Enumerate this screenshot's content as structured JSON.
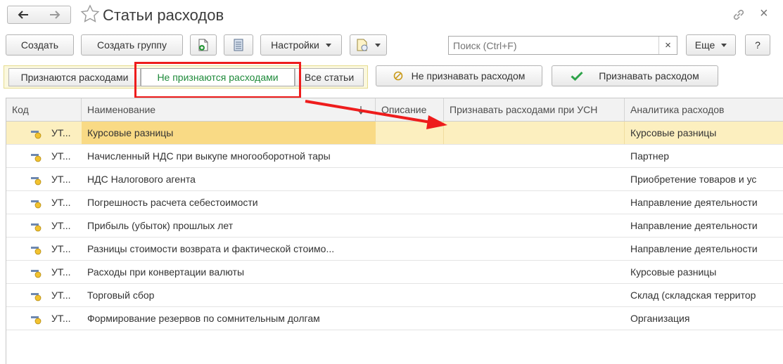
{
  "window": {
    "title": "Статьи расходов",
    "back_icon": "arrow-left-icon",
    "forward_icon": "arrow-right-icon",
    "favorite_icon": "star-icon",
    "link_icon": "link-icon",
    "close_icon": "close-icon"
  },
  "toolbar": {
    "create_label": "Создать",
    "create_group_label": "Создать группу",
    "settings_label": "Настройки",
    "search_placeholder": "Поиск (Ctrl+F)",
    "search_clear": "×",
    "more_label": "Еще",
    "help_label": "?"
  },
  "filters": {
    "tabs": [
      {
        "label": "Признаются расходами"
      },
      {
        "label": "Не признаются расходами",
        "active": true
      },
      {
        "label": "Все статьи"
      }
    ],
    "not_recognize_label": "Не признавать расходом",
    "recognize_label": "Признавать расходом"
  },
  "table": {
    "columns": [
      "Код",
      "Наименование",
      "Описание",
      "Признавать расходами при УСН",
      "Аналитика расходов"
    ],
    "rows": [
      {
        "code": "УТ...",
        "name": "Курсовые разницы",
        "description": "",
        "usn": "",
        "analytics": "Курсовые разницы",
        "selected": true
      },
      {
        "code": "УТ...",
        "name": "Начисленный НДС при выкупе многооборотной тары",
        "description": "",
        "usn": "",
        "analytics": "Партнер"
      },
      {
        "code": "УТ...",
        "name": "НДС Налогового агента",
        "description": "",
        "usn": "",
        "analytics": "Приобретение товаров и ус"
      },
      {
        "code": "УТ...",
        "name": "Погрешность расчета себестоимости",
        "description": "",
        "usn": "",
        "analytics": "Направление деятельности"
      },
      {
        "code": "УТ...",
        "name": "Прибыль (убыток) прошлых лет",
        "description": "",
        "usn": "",
        "analytics": "Направление деятельности"
      },
      {
        "code": "УТ...",
        "name": "Разницы стоимости возврата и фактической стоимо...",
        "description": "",
        "usn": "",
        "analytics": "Направление деятельности"
      },
      {
        "code": "УТ...",
        "name": "Расходы при конвертации валюты",
        "description": "",
        "usn": "",
        "analytics": "Курсовые разницы"
      },
      {
        "code": "УТ...",
        "name": "Торговый сбор",
        "description": "",
        "usn": "",
        "analytics": "Склад (складская территор"
      },
      {
        "code": "УТ...",
        "name": "Формирование резервов по сомнительным долгам",
        "description": "",
        "usn": "",
        "analytics": "Организация"
      }
    ]
  },
  "colors": {
    "accent_green": "#1e8a3a",
    "highlight_red": "#ee1c1c",
    "selected_row": "#fcefbf",
    "selected_cell": "#f9da85"
  }
}
